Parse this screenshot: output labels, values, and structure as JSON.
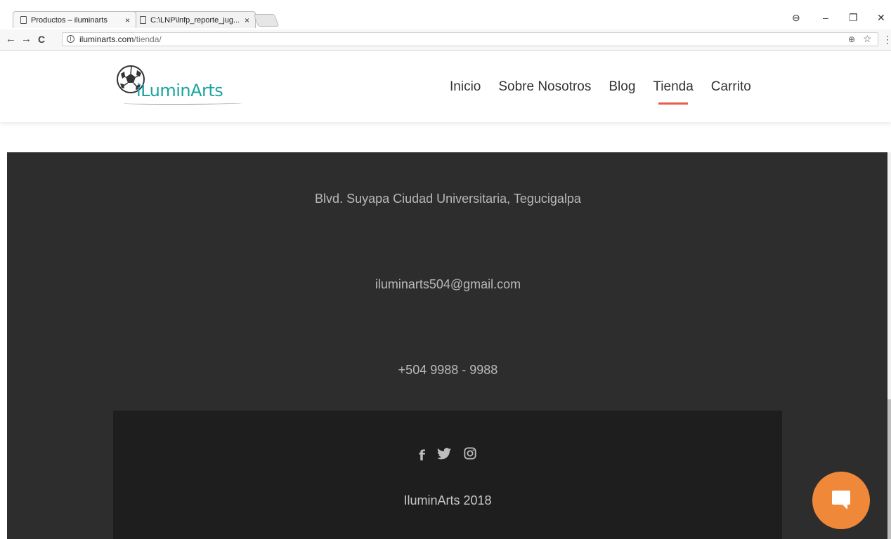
{
  "browser": {
    "tabs": [
      {
        "title": "Productos – iluminarts",
        "close": "×"
      },
      {
        "title": "C:\\LNP\\lnfp_reporte_jug...",
        "close": "×"
      }
    ],
    "url_host": "iluminarts.com",
    "url_path": "/tienda/",
    "nav": {
      "back": "←",
      "forward": "→",
      "reload": "C"
    },
    "info_icon": "ⓘ",
    "zoom_icon": "⊕",
    "star_icon": "☆",
    "menu_icon": "⋮",
    "window": {
      "profile": "⊖",
      "minimize": "–",
      "restore": "❐",
      "close": "✕"
    }
  },
  "site": {
    "logo_text": "iLuminArts",
    "nav": [
      {
        "label": "Inicio"
      },
      {
        "label": "Sobre Nosotros"
      },
      {
        "label": "Blog"
      },
      {
        "label": "Tienda",
        "active": true
      },
      {
        "label": "Carrito"
      }
    ]
  },
  "footer": {
    "address": "Blvd. Suyapa Ciudad Universitaria, Tegucigalpa",
    "email": "iluminarts504@gmail.com",
    "phone": "+504 9988 - 9988",
    "social": {
      "facebook": "f",
      "twitter": "🐦",
      "instagram": "◎"
    },
    "copyright": "IluminArts 2018"
  },
  "colors": {
    "accent": "#e85b49",
    "logo_teal": "#1aa3a3",
    "footer_bg": "#2d2d2d",
    "footer_bottom_bg": "#1e1e1e",
    "chat_orange": "#f0883a"
  }
}
